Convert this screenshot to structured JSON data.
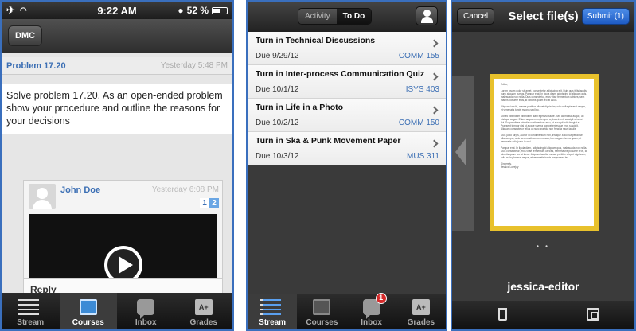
{
  "phone1": {
    "status": {
      "time": "9:22 AM",
      "battery": "52 %"
    },
    "nav": {
      "button": "DMC"
    },
    "post": {
      "title": "Problem 17.20",
      "date": "Yesterday 5:48 PM",
      "body": "Solve problem 17.20. As an open-ended problem show your procedure and outline the reasons for your decisions"
    },
    "submission": {
      "user": "John Doe",
      "date": "Yesterday 6:08 PM",
      "page1": "1",
      "page2": "2"
    },
    "reply": "Reply",
    "tabs": [
      "Stream",
      "Courses",
      "Inbox",
      "Grades"
    ]
  },
  "phone2": {
    "segments": [
      "Activity",
      "To Do"
    ],
    "todos": [
      {
        "title": "Turn in Technical Discussions",
        "due": "Due 9/29/12",
        "course": "COMM 155"
      },
      {
        "title": "Turn in Inter-process Communication Quiz",
        "due": "Due 10/1/12",
        "course": "ISYS 403"
      },
      {
        "title": "Turn in Life in a Photo",
        "due": "Due 10/2/12",
        "course": "COMM 150"
      },
      {
        "title": "Turn in Ska & Punk Movement Paper",
        "due": "Due 10/3/12",
        "course": "MUS 311"
      }
    ],
    "tabs": [
      "Stream",
      "Courses",
      "Inbox",
      "Grades"
    ],
    "inbox_badge": "1"
  },
  "phone3": {
    "cancel": "Cancel",
    "title": "Select file(s)",
    "submit": "Submit (1)",
    "file_name": "jessica-editor",
    "dots": "• •"
  },
  "colors": {
    "link": "#3c6fb4",
    "submit": "#1e5bc4",
    "frame": "#3a6fbd",
    "doc_border": "#e8c12c"
  }
}
